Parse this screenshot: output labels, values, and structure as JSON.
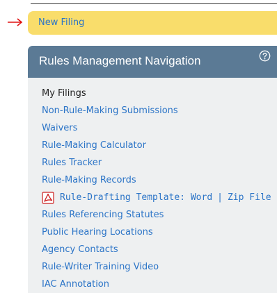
{
  "new_filing": {
    "label": "New Filing",
    "arrow": "→"
  },
  "panel": {
    "title": "Rules Management Navigation",
    "help_icon": "question-circle-icon"
  },
  "nav": {
    "items": [
      "My Filings",
      "Non-Rule-Making Submissions",
      "Waivers",
      "Rule-Making Calculator",
      "Rules Tracker",
      "Rule-Making Records"
    ],
    "template": {
      "prefix": "Rule-Drafting Template:",
      "word": "Word",
      "separator": "|",
      "zip": "Zip File",
      "icon": "pdf-icon"
    },
    "items_after": [
      "Rules Referencing Statutes",
      "Public Hearing Locations",
      "Agency Contacts",
      "Rule-Writer Training Video",
      "IAC Annotation"
    ]
  },
  "colors": {
    "new_filing_bg": "#f9dd6b",
    "link": "#2b74c7",
    "header_bg": "#5b7a95",
    "panel_bg": "#eef0f1",
    "arrow": "#e01010"
  }
}
